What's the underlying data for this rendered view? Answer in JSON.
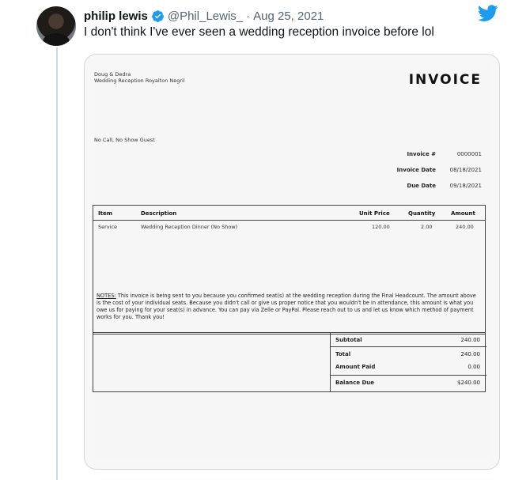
{
  "tweet": {
    "author_name": "philip lewis",
    "handle": "@Phil_Lewis_",
    "separator": "·",
    "date": "Aug 25, 2021",
    "text": "I don't think I've ever seen a wedding reception invoice before lol"
  },
  "colors": {
    "twitter_blue": "#1d9bf0",
    "muted": "#536471"
  },
  "icons": {
    "verified": "verified-badge-icon",
    "brand": "twitter-bird-icon"
  },
  "invoice": {
    "from_line1": "Doug & Dedra",
    "from_line2": "Wedding Reception Royalton Negril",
    "title": "INVOICE",
    "bill_to": "No Call, No Show Guest",
    "meta": {
      "invoice_no_label": "Invoice #",
      "invoice_no": "0000001",
      "invoice_date_label": "Invoice Date",
      "invoice_date": "08/18/2021",
      "due_date_label": "Due Date",
      "due_date": "09/18/2021"
    },
    "table": {
      "headers": {
        "item": "Item",
        "description": "Description",
        "unit_price": "Unit Price",
        "quantity": "Quantity",
        "amount": "Amount"
      },
      "rows": [
        {
          "item": "Service",
          "description": "Wedding Reception Dinner (No Show)",
          "unit_price": "120.00",
          "quantity": "2.00",
          "amount": "240.00"
        }
      ]
    },
    "notes_label": "NOTES:",
    "notes_text": " This invoice is being sent to you because you confirmed seat(s) at the wedding reception during the Final Headcount. The amount above is the cost of your individual seats. Because you didn't call or give us proper notice that you wouldn't be in attendance, this amount is what you owe us for paying for your seat(s) in advance. You can pay via Zelle or PayPal. Please reach out to us and let us know which method of payment works for you. Thank you!",
    "totals": {
      "subtotal_label": "Subtotal",
      "subtotal": "240.00",
      "total_label": "Total",
      "total": "240.00",
      "paid_label": "Amount Paid",
      "paid": "0.00",
      "balance_label": "Balance Due",
      "balance": "$240.00"
    }
  }
}
